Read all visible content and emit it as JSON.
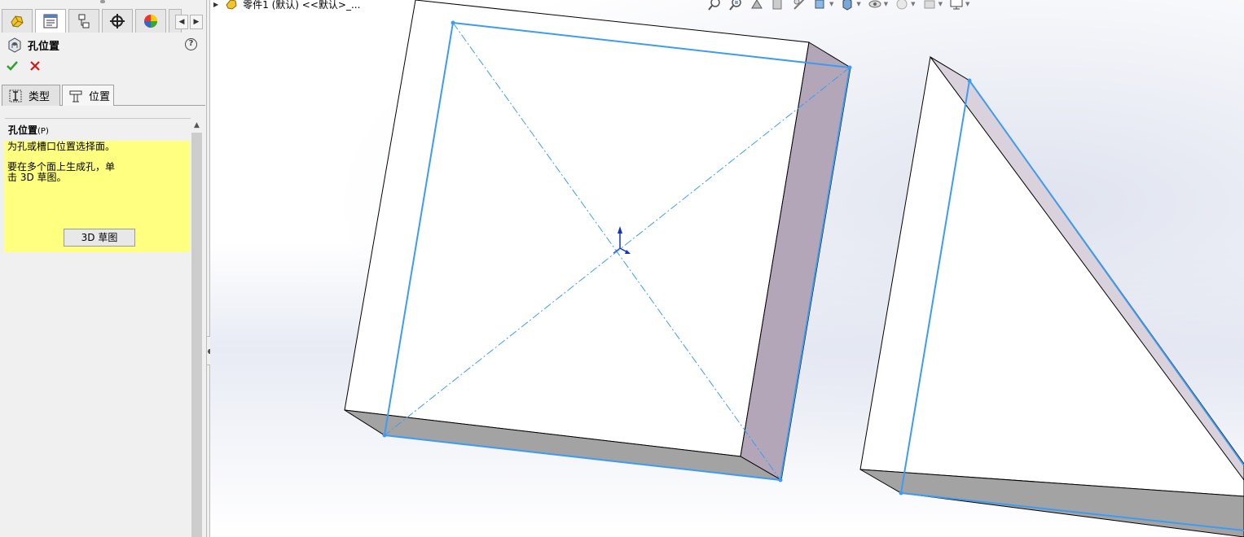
{
  "panel": {
    "manager_tabs": [
      "feature-manager",
      "property-manager",
      "configuration-manager",
      "dimxpert-manager",
      "display-manager",
      "more"
    ],
    "title": "孔位置",
    "help": "?",
    "sub_tabs": [
      {
        "label": "类型",
        "icon": "hole-type-icon"
      },
      {
        "label": "位置",
        "icon": "hole-position-icon"
      }
    ],
    "group": {
      "title": "孔位置",
      "shortcut": "(P)",
      "message_line1": "为孔或槽口位置选择面。",
      "message_line2": "要在多个面上生成孔，单",
      "message_line3": "击 3D 草图。",
      "button": "3D 草图"
    }
  },
  "viewport": {
    "breadcrumb": "零件1 (默认) <<默认>_...",
    "heads_up_icons": [
      "zoom-to-fit-icon",
      "zoom-area-icon",
      "previous-view-icon",
      "section-view-icon",
      "dynamic-annotation-icon",
      "view-orientation-icon",
      "display-style-icon",
      "hide-show-items-icon",
      "edit-appearance-icon",
      "apply-scene-icon",
      "view-settings-icon"
    ]
  },
  "colors": {
    "sketch_blue": "#3d9cf0",
    "side_face": "#b2a6b8",
    "bottom_face": "#a3a3a3",
    "message_bg": "#ffff80",
    "accept_green": "#2ea12e",
    "cancel_red": "#d01818"
  }
}
